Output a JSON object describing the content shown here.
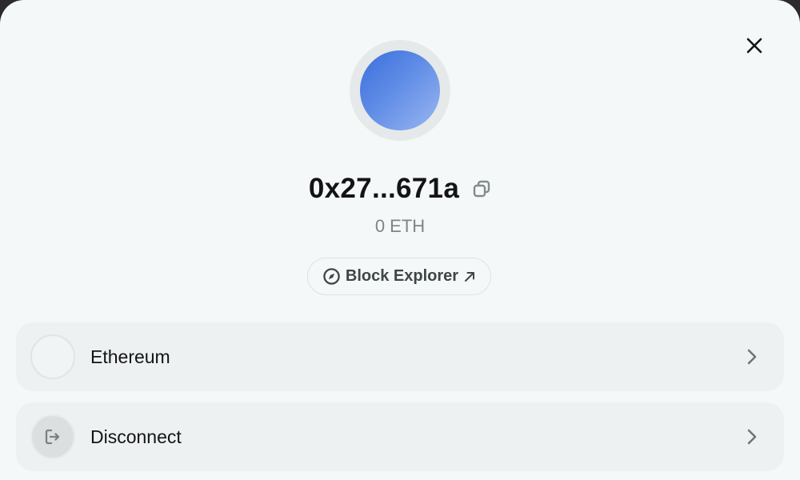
{
  "account": {
    "address": "0x27...671a",
    "balance": "0 ETH"
  },
  "actions": {
    "block_explorer_label": "Block Explorer"
  },
  "rows": [
    {
      "label": "Ethereum",
      "icon": "network-placeholder-icon"
    },
    {
      "label": "Disconnect",
      "icon": "logout-icon"
    }
  ],
  "colors": {
    "background": "#f4f8f8",
    "row_background": "#eef1f1",
    "avatar_gradient_start": "#3a6fdc",
    "avatar_gradient_end": "#9ab7f2",
    "text_primary": "#141414",
    "text_secondary": "#7d8585"
  },
  "icons": {
    "close": "close-icon",
    "copy": "copy-icon",
    "explorer": "compass-icon",
    "external": "arrow-up-right-icon",
    "chevron": "chevron-right-icon"
  }
}
